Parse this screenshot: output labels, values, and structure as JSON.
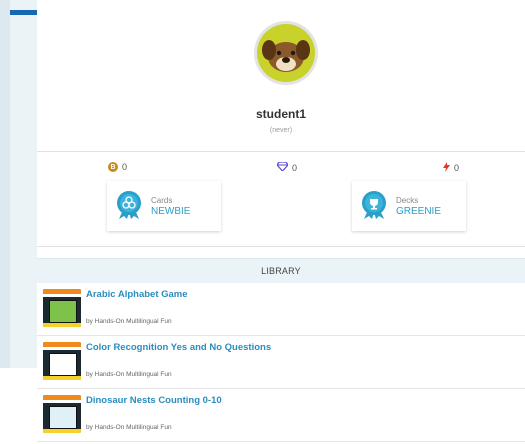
{
  "profile": {
    "username": "student1",
    "last_seen": "(never)",
    "avatar_bg": "#c8d22a"
  },
  "stats": {
    "coins": "0",
    "gems": "0",
    "energy": "0",
    "coin_letter": "B"
  },
  "badges": [
    {
      "label": "Cards",
      "level": "NEWBIE"
    },
    {
      "label": "Decks",
      "level": "GREENIE"
    }
  ],
  "library": {
    "title": "LIBRARY",
    "items": [
      {
        "title": "Arabic Alphabet Game",
        "author": "by Hands-On Multilingual Fun",
        "screen_color": "#7fc24a"
      },
      {
        "title": "Color Recognition Yes and No Questions",
        "author": "by Hands-On Multilingual Fun",
        "screen_color": "#ffffff"
      },
      {
        "title": "Dinosaur Nests Counting 0-10",
        "author": "by Hands-On Multilingual Fun",
        "screen_color": "#dff0f7"
      }
    ]
  },
  "colors": {
    "accent": "#1668b2",
    "link": "#2a8dbf",
    "badge": "#2a9fc7"
  }
}
